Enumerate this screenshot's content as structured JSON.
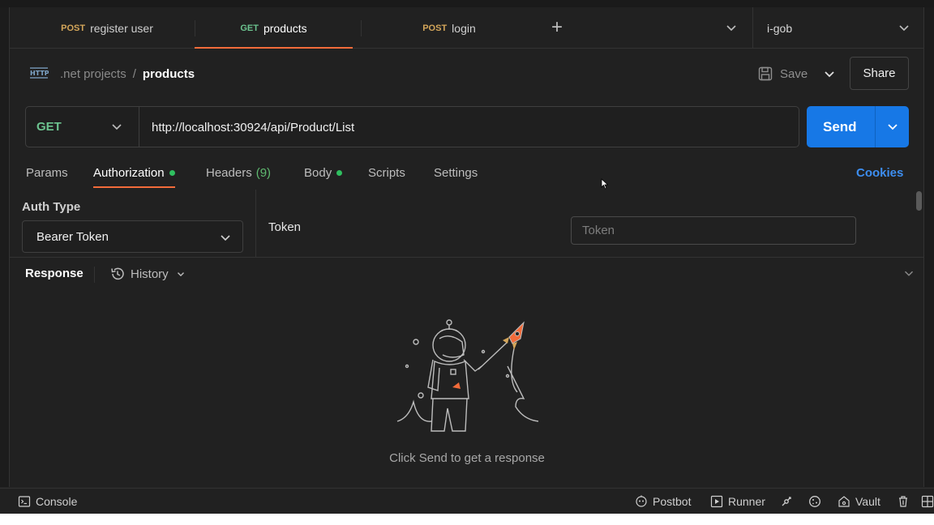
{
  "tabs": [
    {
      "method": "POST",
      "name": "register user"
    },
    {
      "method": "GET",
      "name": "products"
    },
    {
      "method": "POST",
      "name": "login"
    }
  ],
  "tabbar": {
    "new_tab_label": "+"
  },
  "environment": {
    "name": "i-gob"
  },
  "breadcrumb": {
    "parent": ".net projects",
    "separator": "/",
    "current": "products"
  },
  "toolbar": {
    "save_label": "Save",
    "share_label": "Share"
  },
  "request": {
    "method": "GET",
    "url": "http://localhost:30924/api/Product/List",
    "send_label": "Send"
  },
  "request_tabs": [
    {
      "label": "Params"
    },
    {
      "label": "Authorization",
      "indicator": true
    },
    {
      "label": "Headers",
      "count": "(9)"
    },
    {
      "label": "Body",
      "indicator": true
    },
    {
      "label": "Scripts"
    },
    {
      "label": "Settings"
    }
  ],
  "cookies_label": "Cookies",
  "auth": {
    "type_label": "Auth Type",
    "type_value": "Bearer Token",
    "token_label": "Token",
    "token_placeholder": "Token"
  },
  "response": {
    "label": "Response",
    "history_label": "History",
    "empty_message": "Click Send to get a response"
  },
  "statusbar": {
    "console": "Console",
    "postbot": "Postbot",
    "runner": "Runner",
    "vault": "Vault"
  },
  "colors": {
    "accent_orange": "#f26b3a",
    "send_blue": "#1778e6",
    "get_green": "#6cc38f",
    "post_orange": "#d4a65a",
    "cookies_blue": "#3d8ef0",
    "status_dot": "#2fbf5f"
  }
}
